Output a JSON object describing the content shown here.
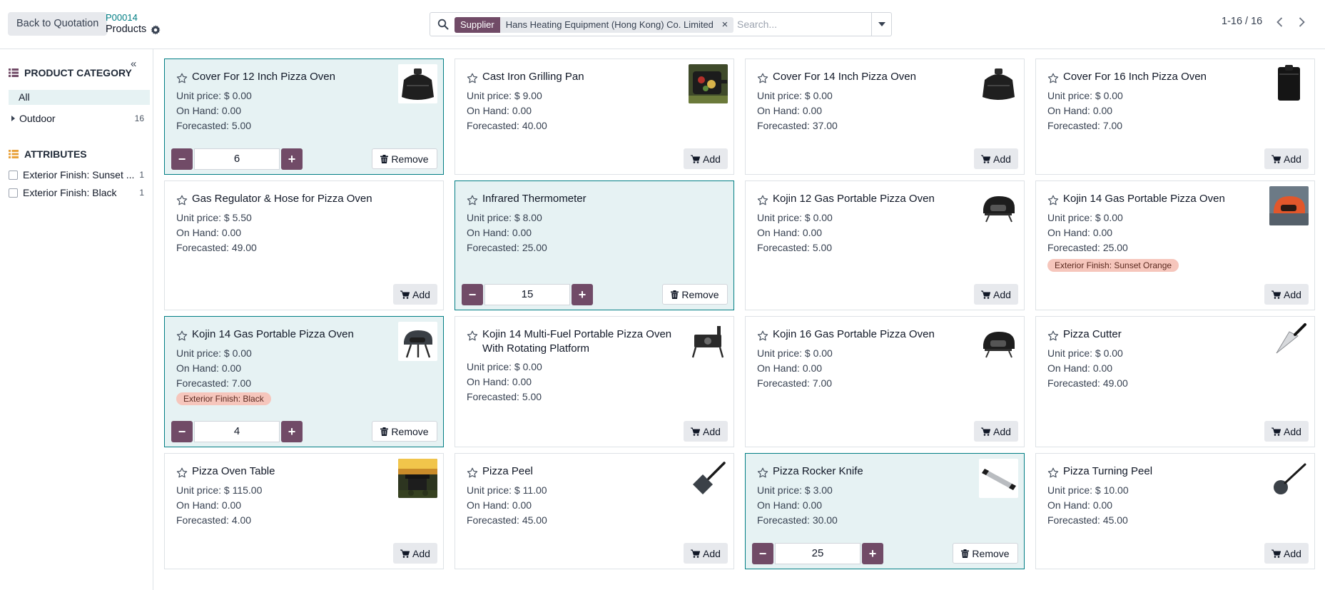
{
  "header": {
    "back_label": "Back to Quotation",
    "breadcrumb_ref": "P00014",
    "breadcrumb_title": "Products",
    "search": {
      "facet_name": "Supplier",
      "facet_value": "Hans Heating Equipment (Hong Kong) Co. Limited",
      "placeholder": "Search..."
    },
    "pager": "1-16 / 16"
  },
  "sidebar": {
    "category_title": "PRODUCT CATEGORY",
    "all_label": "All",
    "categories": [
      {
        "label": "Outdoor",
        "count": "16"
      }
    ],
    "attributes_title": "ATTRIBUTES",
    "attributes": [
      {
        "label": "Exterior Finish: Sunset ...",
        "count": "1"
      },
      {
        "label": "Exterior Finish: Black",
        "count": "1"
      }
    ]
  },
  "labels": {
    "add": "Add",
    "remove": "Remove"
  },
  "products": [
    {
      "name": "Cover For 12 Inch Pizza Oven",
      "price": "Unit price: $ 0.00",
      "on_hand": "On Hand: 0.00",
      "forecast": "Forecasted: 5.00",
      "qty": "6",
      "img": "cover"
    },
    {
      "name": "Cast Iron Grilling Pan",
      "price": "Unit price: $ 9.00",
      "on_hand": "On Hand: 0.00",
      "forecast": "Forecasted: 40.00",
      "img": "grillpan"
    },
    {
      "name": "Cover For 14 Inch Pizza Oven",
      "price": "Unit price: $ 0.00",
      "on_hand": "On Hand: 0.00",
      "forecast": "Forecasted: 37.00",
      "img": "cover"
    },
    {
      "name": "Cover For 16 Inch Pizza Oven",
      "price": "Unit price: $ 0.00",
      "on_hand": "On Hand: 0.00",
      "forecast": "Forecasted: 7.00",
      "img": "bag"
    },
    {
      "name": "Gas Regulator & Hose for Pizza Oven",
      "price": "Unit price: $ 5.50",
      "on_hand": "On Hand: 0.00",
      "forecast": "Forecasted: 49.00"
    },
    {
      "name": "Infrared Thermometer",
      "price": "Unit price: $ 8.00",
      "on_hand": "On Hand: 0.00",
      "forecast": "Forecasted: 25.00",
      "qty": "15"
    },
    {
      "name": "Kojin 12 Gas Portable Pizza Oven",
      "price": "Unit price: $ 0.00",
      "on_hand": "On Hand: 0.00",
      "forecast": "Forecasted: 5.00",
      "img": "oven-black"
    },
    {
      "name": "Kojin 14 Gas Portable Pizza Oven",
      "price": "Unit price: $ 0.00",
      "on_hand": "On Hand: 0.00",
      "forecast": "Forecasted: 25.00",
      "tag": "Exterior Finish: Sunset Orange",
      "img": "oven-orange"
    },
    {
      "name": "Kojin 14 Gas Portable Pizza Oven",
      "price": "Unit price: $ 0.00",
      "on_hand": "On Hand: 0.00",
      "forecast": "Forecasted: 7.00",
      "tag": "Exterior Finish: Black",
      "qty": "4",
      "img": "oven-stand"
    },
    {
      "name": "Kojin 14 Multi-Fuel Portable Pizza Oven With Rotating Platform",
      "price": "Unit price: $ 0.00",
      "on_hand": "On Hand: 0.00",
      "forecast": "Forecasted: 5.00",
      "img": "multifuel"
    },
    {
      "name": "Kojin 16 Gas Portable Pizza Oven",
      "price": "Unit price: $ 0.00",
      "on_hand": "On Hand: 0.00",
      "forecast": "Forecasted: 7.00",
      "img": "oven-black"
    },
    {
      "name": "Pizza Cutter",
      "price": "Unit price: $ 0.00",
      "on_hand": "On Hand: 0.00",
      "forecast": "Forecasted: 49.00",
      "img": "cutter"
    },
    {
      "name": "Pizza Oven Table",
      "price": "Unit price: $ 115.00",
      "on_hand": "On Hand: 0.00",
      "forecast": "Forecasted: 4.00",
      "img": "table"
    },
    {
      "name": "Pizza Peel",
      "price": "Unit price: $ 11.00",
      "on_hand": "On Hand: 0.00",
      "forecast": "Forecasted: 45.00",
      "img": "peel"
    },
    {
      "name": "Pizza Rocker Knife",
      "price": "Unit price: $ 3.00",
      "on_hand": "On Hand: 0.00",
      "forecast": "Forecasted: 30.00",
      "qty": "25",
      "img": "rocker"
    },
    {
      "name": "Pizza Turning Peel",
      "price": "Unit price: $ 10.00",
      "on_hand": "On Hand: 0.00",
      "forecast": "Forecasted: 45.00",
      "img": "turning"
    }
  ],
  "colors": {
    "primary": "#714b67",
    "selected_bg": "#e6f2f3",
    "selected_border": "#017e84",
    "tag_bg": "#f6c6bc"
  }
}
